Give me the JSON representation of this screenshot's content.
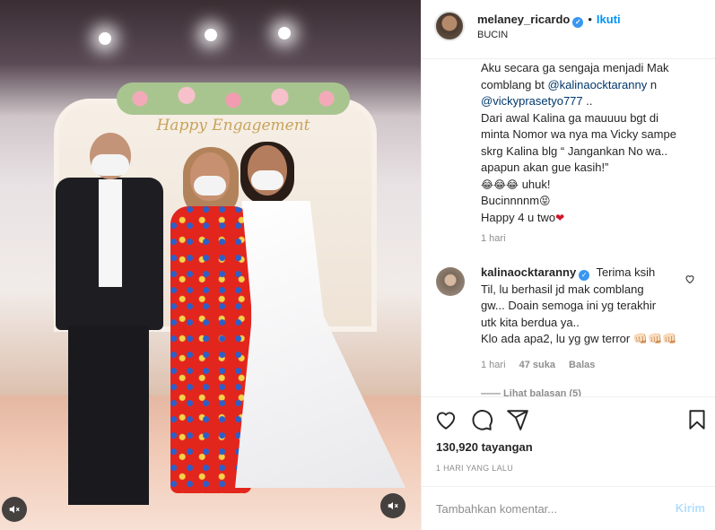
{
  "media": {
    "sign_text": "Happy Engagement",
    "mute_icon": "speaker-muted-icon"
  },
  "header": {
    "username": "melaney_ricardo",
    "separator": "•",
    "follow_label": "Ikuti",
    "location": "BUCIN",
    "verified_icon": "verified-badge-icon"
  },
  "caption": {
    "line1": "Aku secara ga sengaja menjadi Mak",
    "line2_pre": "comblang bt ",
    "line2_mention": "@kalinaocktaranny",
    "line2_post": " n",
    "line3_mention": "@vickyprasetyo777",
    "line3_post": " ..",
    "line4": "Dari awal Kalina ga mauuuu bgt di",
    "line5": "minta Nomor wa nya ma Vicky sampe",
    "line6": "skrg Kalina blg “ Jangankan No wa..",
    "line7": "apapun akan gue kasih!”",
    "line8_emoji": "😂😂😂",
    "line8_text": " uhuk!",
    "line9_text": "Bucinnnnm",
    "line9_emoji": "😝",
    "line10_text": "Happy 4 u two",
    "line10_emoji": "❤",
    "time": "1 hari"
  },
  "comment": {
    "username": "kalinaocktaranny",
    "line1_text": "Terima ksih",
    "line2": "Til, lu berhasil jd mak comblang",
    "line3": "gw... Doain semoga ini yg terakhir",
    "line4": "utk kita berdua ya..",
    "line5": "Klo ada apa2, lu yg gw terror 👊🏻👊🏻👊🏻",
    "time": "1 hari",
    "likes": "47 suka",
    "reply": "Balas",
    "view_replies": "—— Lihat balasan (5)"
  },
  "actions": {
    "icons": [
      "heart-icon",
      "comment-icon",
      "share-icon",
      "bookmark-icon"
    ],
    "views": "130,920 tayangan",
    "date": "1 HARI YANG LALU"
  },
  "add_comment": {
    "placeholder": "Tambahkan komentar...",
    "post_label": "Kirim"
  }
}
